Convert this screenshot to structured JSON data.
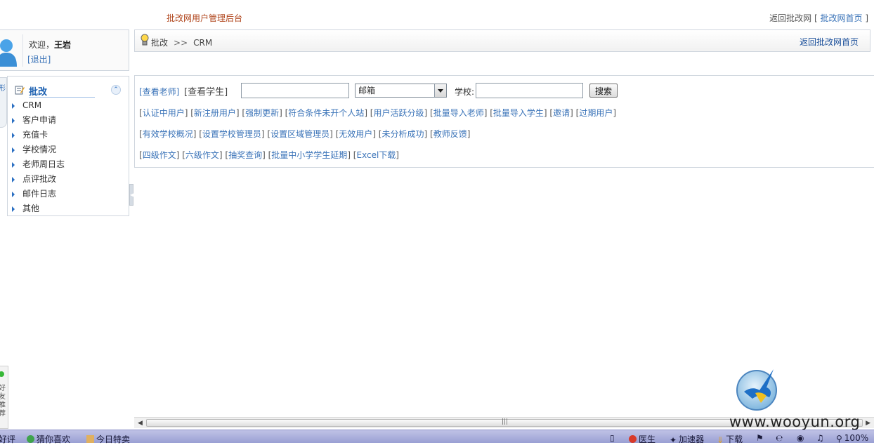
{
  "header": {
    "site_title": "批改网用户管理后台",
    "back_prefix": "返回批改网 [",
    "back_link": "批改网首页",
    "back_suffix": "]"
  },
  "user": {
    "welcome": "欢迎，",
    "name": "王岩",
    "logout": "[退出]"
  },
  "side_strip_text": "形",
  "menu": {
    "title": "批改",
    "items": [
      "CRM",
      "客户申请",
      "充值卡",
      "学校情况",
      "老师周日志",
      "点评批改",
      "邮件日志",
      "其他"
    ]
  },
  "breadcrumb": {
    "root": "批改",
    "separator": ">>",
    "current": "CRM",
    "back_home": "返回批改网首页"
  },
  "search": {
    "view_teacher": "[查看老师]",
    "view_student": "[查看学生]",
    "keyword_value": "",
    "field_selected": "邮箱",
    "school_label": "学校:",
    "school_value": "",
    "button": "搜索"
  },
  "link_rows": [
    [
      "认证中用户",
      "新注册用户",
      "强制更新",
      "符合条件未开个人站",
      "用户活跃分级",
      "批量导入老师",
      "批量导入学生",
      "邀请",
      "过期用户"
    ],
    [
      "有效学校概况",
      "设置学校管理员",
      "设置区域管理员",
      "无效用户",
      "未分析成功",
      "教师反馈"
    ],
    [
      "四级作文",
      "六级作文",
      "抽奖查询",
      "批量中小学学生延期",
      "Excel下载"
    ]
  ],
  "side_widget_text": "好友推荐",
  "status_bar": {
    "left": [
      "好评",
      "猜你喜欢",
      "今日特卖"
    ],
    "right": [
      "医生",
      "加速器",
      "下载"
    ],
    "zoom": "100%"
  },
  "watermark": "www.wooyun.org",
  "colors": {
    "link": "#3a73b8",
    "site_title": "#b0451c",
    "menu_title": "#1a5fb0",
    "status_bar": "#9aa0d4"
  },
  "icons": [
    "user-avatar-icon",
    "edit-icon",
    "collapse-up-icon",
    "bulb-icon",
    "menu-arrow-icon",
    "bird-logo-icon"
  ]
}
